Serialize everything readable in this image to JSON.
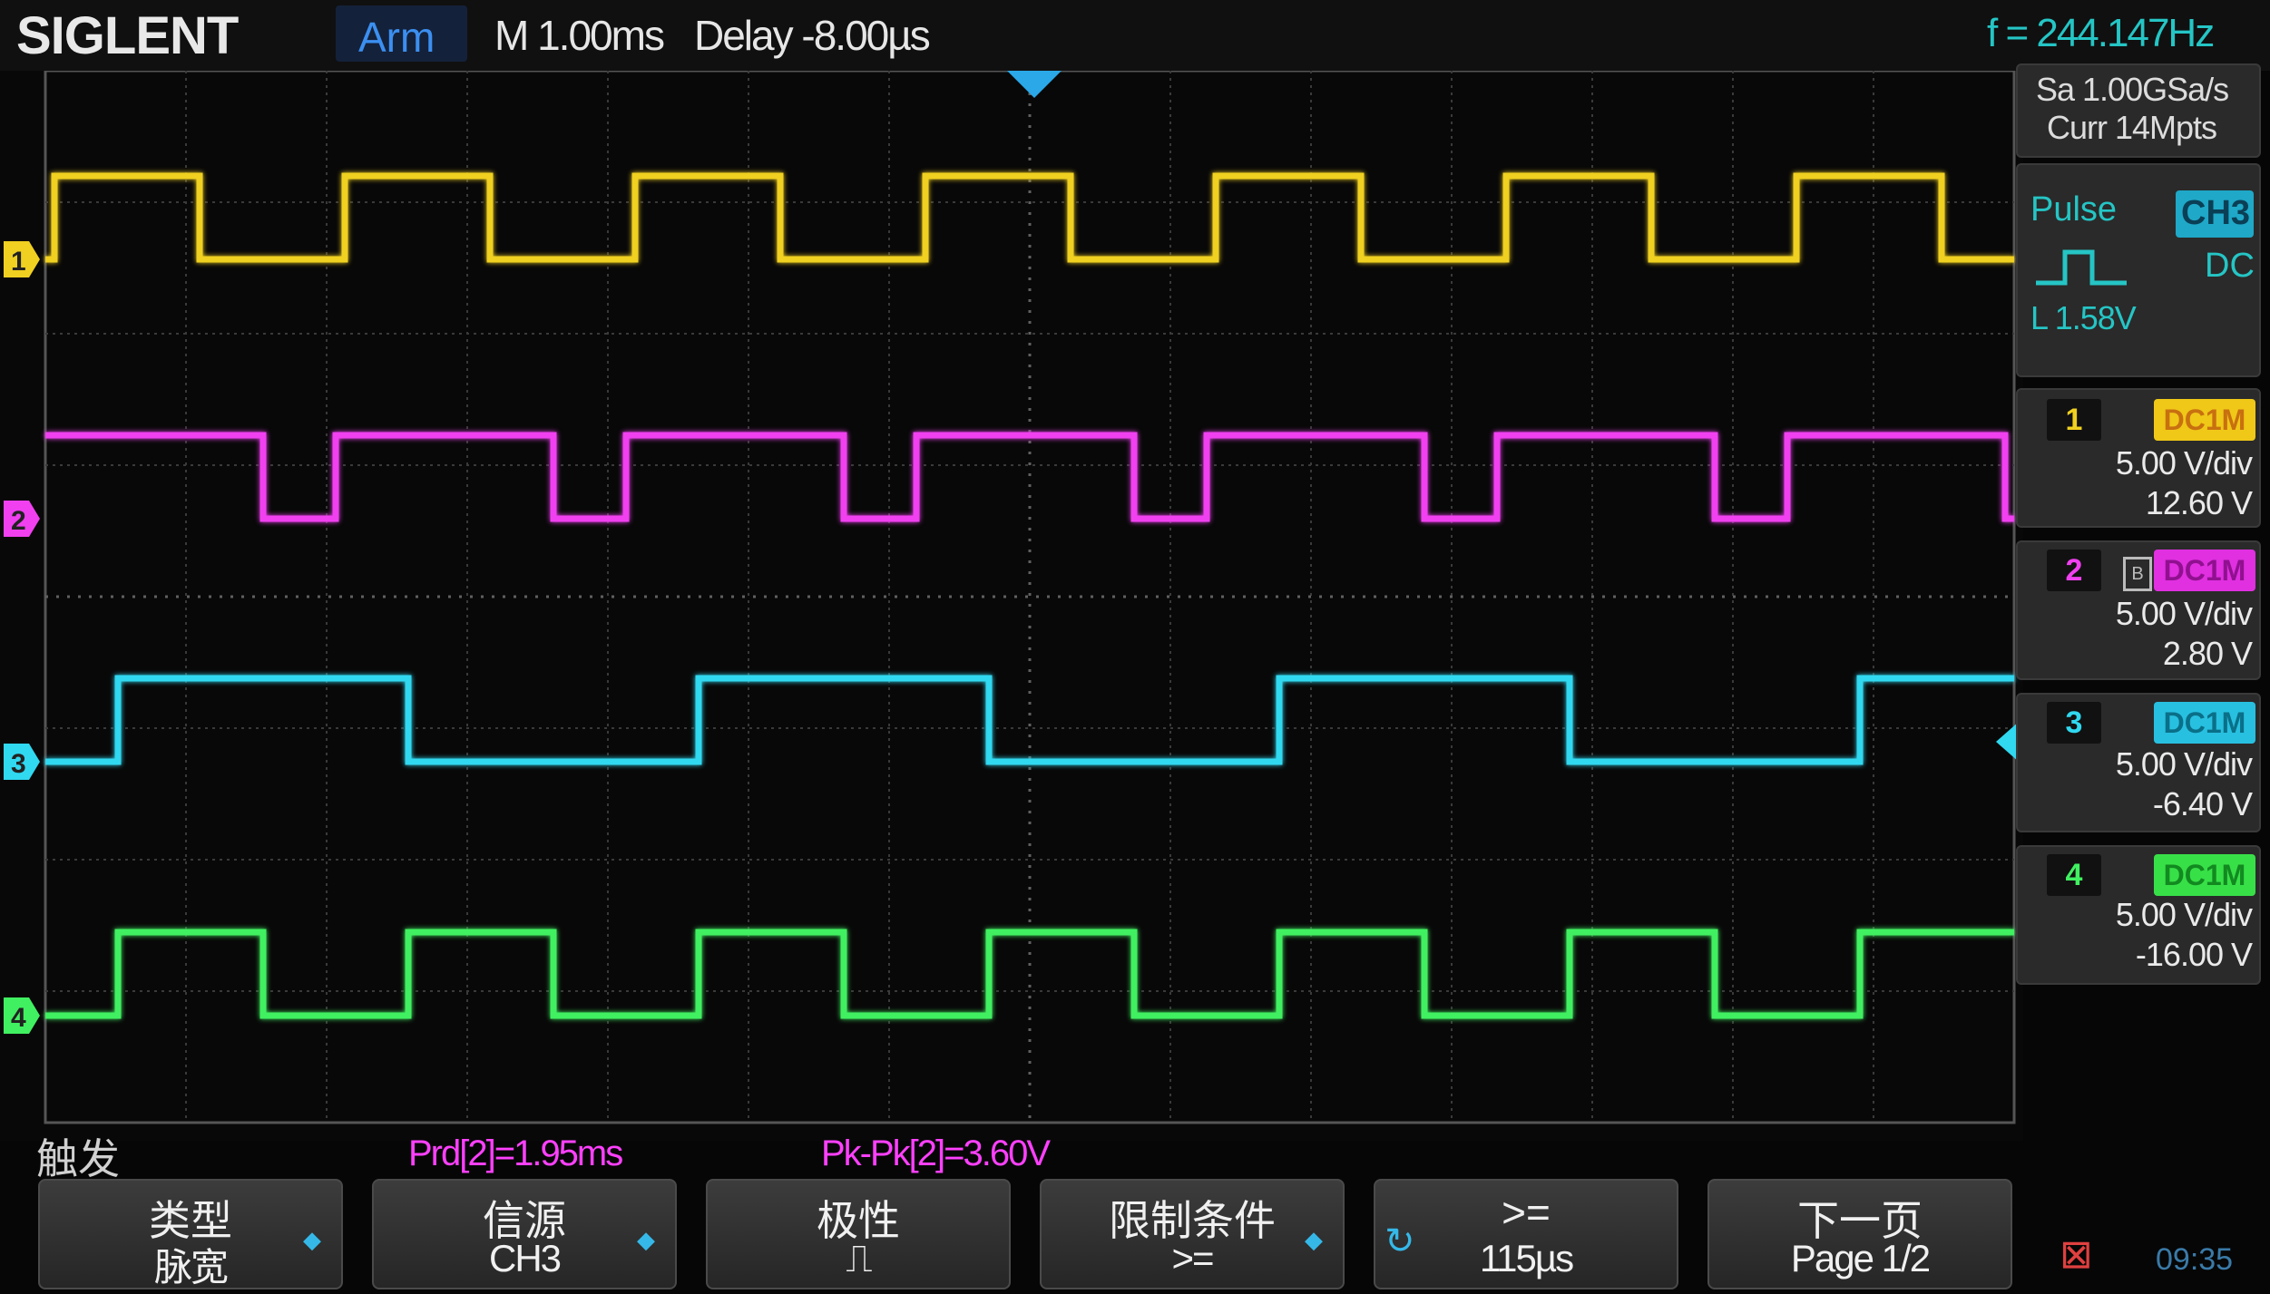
{
  "header": {
    "brand": "SIGLENT",
    "run_state": "Arm",
    "timebase": "M 1.00ms",
    "delay": "Delay -8.00µs",
    "frequency": "f = 244.147Hz"
  },
  "acquisition": {
    "sample_rate": "Sa 1.00GSa/s",
    "memory": "Curr 14Mpts"
  },
  "trigger_info": {
    "type": "Pulse",
    "source": "CH3",
    "coupling": "DC",
    "level": "L  1.58V"
  },
  "channels": [
    {
      "number": "1",
      "coupling": "DC1M",
      "scale": "5.00 V/div",
      "offset": "12.60 V",
      "color": "#f0d020"
    },
    {
      "number": "2",
      "coupling": "DC1M",
      "scale": "5.00 V/div",
      "offset": "2.80 V",
      "color": "#f040f0"
    },
    {
      "number": "3",
      "coupling": "DC1M",
      "scale": "5.00 V/div",
      "offset": "-6.40 V",
      "color": "#30d8f0"
    },
    {
      "number": "4",
      "coupling": "DC1M",
      "scale": "5.00 V/div",
      "offset": "-16.00 V",
      "color": "#40f060"
    }
  ],
  "channel_markers": [
    "1",
    "2",
    "3",
    "4"
  ],
  "menu": {
    "title": "触发",
    "measurements": [
      "Prd[2]=1.95ms",
      "Pk-Pk[2]=3.60V"
    ],
    "softkeys": [
      {
        "line1": "类型",
        "line2": "脉宽"
      },
      {
        "line1": "信源",
        "line2": "CH3"
      },
      {
        "line1": "极性",
        "line2": "⎍"
      },
      {
        "line1": "限制条件",
        "line2": ">="
      },
      {
        "line1": ">=",
        "line2": "115µs"
      },
      {
        "line1": "下一页",
        "line2": "Page 1/2"
      }
    ]
  },
  "status": {
    "clock": "09:35"
  }
}
